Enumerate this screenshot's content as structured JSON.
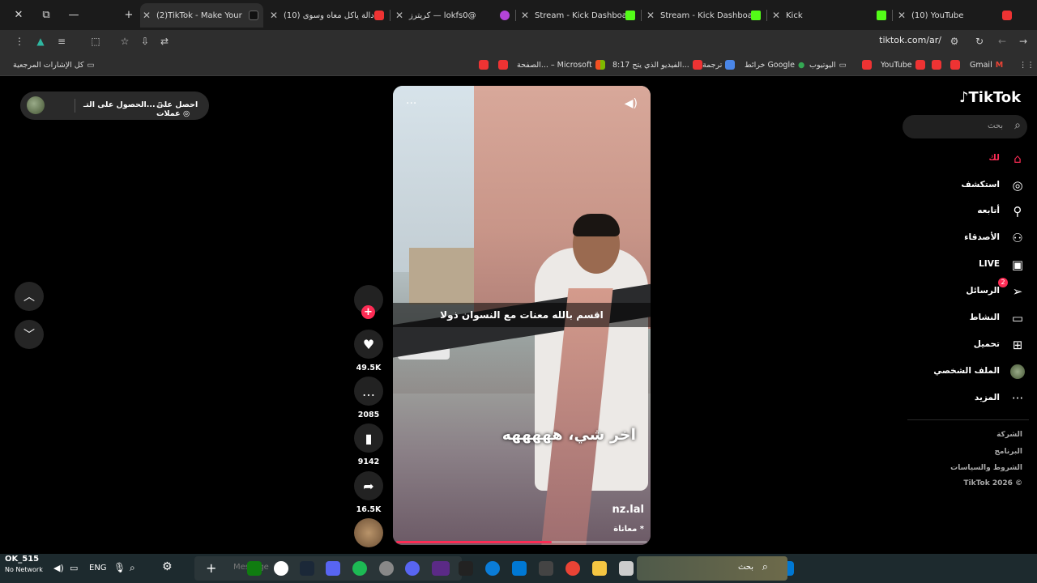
{
  "window": {
    "close": "✕",
    "restore": "⧉",
    "minimize": "—",
    "new_tab": "+"
  },
  "tabs": [
    {
      "title": "(2)TikTok - Make Your",
      "icon": "tiktok",
      "active": true
    },
    {
      "title": "(10) نادالة ياكل معاه وسوى",
      "icon": "youtube"
    },
    {
      "title": "كريترز — lokfs0@",
      "icon": "purple"
    },
    {
      "title": "Stream - Kick Dashboard",
      "icon": "kick"
    },
    {
      "title": "Stream - Kick Dashboard",
      "icon": "kick"
    },
    {
      "title": "Kick",
      "icon": "kick"
    },
    {
      "title": "(10) YouTube",
      "icon": "youtube"
    }
  ],
  "toolbar": {
    "url": "tiktok.com/ar/"
  },
  "bookmarks": [
    {
      "label": "كل الإشارات المرجعية",
      "icon": "folder"
    },
    {
      "label": "Gmail",
      "icon": "gmail"
    },
    {
      "label": "YouTube",
      "icon": "youtube"
    },
    {
      "label": "اليوتيوب",
      "icon": "folder"
    },
    {
      "label": "خرائط Google",
      "icon": "maps"
    },
    {
      "label": "ترجمة",
      "icon": "translate"
    },
    {
      "label": "8:17 الفيديو الذي يتح...",
      "icon": "youtube"
    },
    {
      "label": "الصفحة... – Microsoft",
      "icon": "microsoft"
    }
  ],
  "pill": {
    "get_coins": "احصل على عملات",
    "get_app": "الحصول على التـ..."
  },
  "video": {
    "subtitle_top": "اقسم بالله معنات مع النسوان ذولا",
    "subtitle_big": "اخر شي، هههههه",
    "author": "nz.lal",
    "description": "معاناة *",
    "progress": 0.62
  },
  "actions": {
    "likes": "49.5K",
    "comments": "2085",
    "saves": "9142",
    "shares": "16.5K"
  },
  "sidebar": {
    "logo": "TikTok",
    "search_placeholder": "بحث",
    "items": [
      {
        "label": "لك",
        "icon": "home-icon"
      },
      {
        "label": "استكشف",
        "icon": "compass-icon"
      },
      {
        "label": "أتابعه",
        "icon": "following-icon"
      },
      {
        "label": "الأصدقاء",
        "icon": "friends-icon"
      },
      {
        "label": "LIVE",
        "icon": "live-icon"
      },
      {
        "label": "الرسائل",
        "icon": "messages-icon",
        "badge": "2"
      },
      {
        "label": "النشاط",
        "icon": "activity-icon"
      },
      {
        "label": "تحميل",
        "icon": "upload-icon"
      },
      {
        "label": "الملف الشخصي",
        "icon": "avatar"
      },
      {
        "label": "المزيد",
        "icon": "more-icon"
      }
    ],
    "footer": [
      "الشركة",
      "البرنامج",
      "الشروط والسياسات",
      "TikTok 2026 ©"
    ]
  },
  "taskbar": {
    "network": "OK_515",
    "network_sub": "No Network",
    "lang": "ENG",
    "search_placeholder": "بحث",
    "chat_placeholder": "Message"
  }
}
